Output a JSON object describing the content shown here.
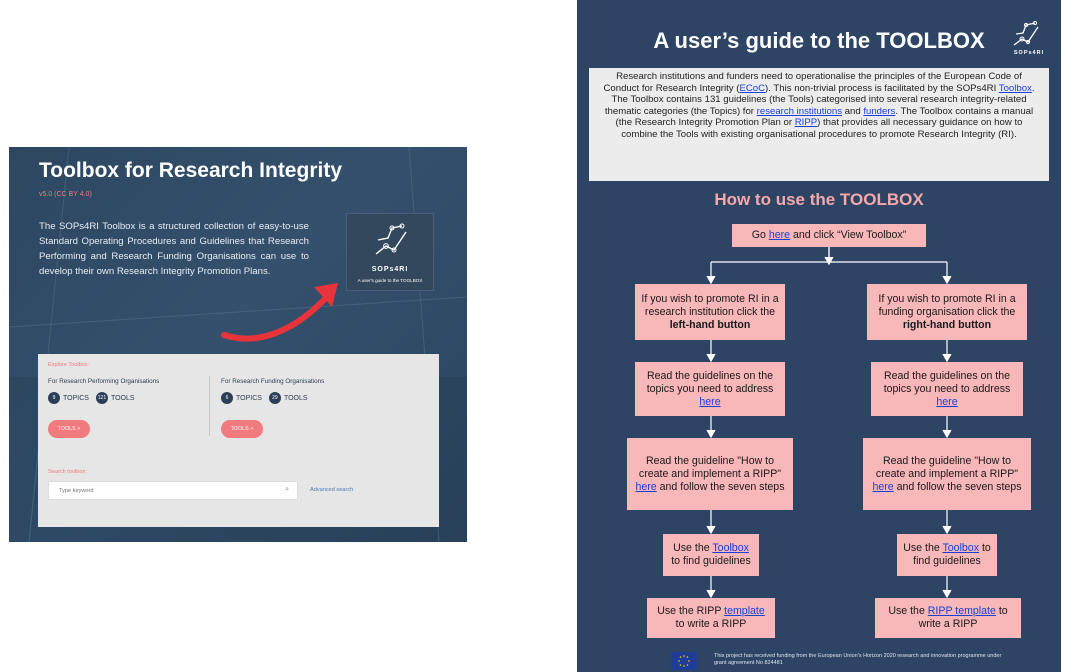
{
  "left_panel": {
    "title": "Toolbox for Research Integrity",
    "version": "v5.0 (CC BY 4.0)",
    "description": "The SOPs4RI Toolbox is a structured collection of easy-to-use Standard Operating Procedures and Guidelines that Research Performing and Research Funding Organisations can use to develop their own Research Integrity Promotion Plans.",
    "badge": {
      "brand": "SOPs4RI",
      "caption": "A user's guide to the TOOLBOX"
    },
    "explore": {
      "label": "Explore Toolbox:",
      "rpo": {
        "title": "For Research Performing Organisations",
        "topics_count": "9",
        "topics_label": "TOPICS",
        "tools_count": "121",
        "tools_label": "TOOLS",
        "button": "TOOLS >"
      },
      "rfo": {
        "title": "For Research Funding Organisations",
        "topics_count": "6",
        "topics_label": "TOPICS",
        "tools_count": "29",
        "tools_label": "TOOLS",
        "button": "TOOLS >"
      },
      "search_label": "Search toolbox:",
      "search_placeholder": "Type keyword",
      "advanced_search": "Advanced search"
    }
  },
  "poster": {
    "title": "A user’s guide to the TOOLBOX",
    "logo_text": "SOPs4RI",
    "intro": {
      "t1": "Research institutions and funders need to operationalise the principles of the European Code of Conduct for Research Integrity (",
      "l1": "ECoC",
      "t2": "). This non-trivial process is facilitated by the SOPs4RI ",
      "l2": "Toolbox",
      "t3": ". The Toolbox contains 131 guidelines (the Tools) categorised into several research integrity-related thematic categories (the Topics) for ",
      "l3": "research institutions",
      "t4": " and ",
      "l4": "funders",
      "t5": ". The Toolbox contains a manual (the Research Integrity Promotion Plan or ",
      "l5": "RIPP",
      "t6": ") that provides all necessary guidance on how to combine the Tools with existing organisational procedures to promote Research Integrity (RI)."
    },
    "how_title": "How to use the TOOLBOX",
    "start": {
      "t1": "Go ",
      "link": "here",
      "t2": " and click “View Toolbox”"
    },
    "left_col": {
      "b1_pre": "If you wish to promote RI in a research institution click the ",
      "b1_bold": "left-hand button",
      "b2_text": "Read the guidelines on the topics you need to address",
      "b2_link": "here",
      "b3_text": "Read the guideline \"How to create and implement a RIPP\"",
      "b3_link": "here",
      "b3_tail": " and follow the seven steps",
      "b4_pre": "Use the ",
      "b4_link": "Toolbox",
      "b4_tail": " to find guidelines",
      "b5_pre": "Use the RIPP ",
      "b5_link": "template",
      "b5_tail": " to write a RIPP"
    },
    "right_col": {
      "b1_pre": "If you wish to promote RI in a funding organisation click the ",
      "b1_bold": "right-hand button",
      "b2_text": "Read the guidelines on the topics you need to address",
      "b2_link": "here",
      "b3_text": "Read the guideline \"How to create and implement a RIPP\"",
      "b3_link": "here",
      "b3_tail": " and follow the seven steps",
      "b4_pre": "Use the ",
      "b4_link": "Toolbox",
      "b4_tail": " to find guidelines",
      "b5_pre": "Use the ",
      "b5_link": "RIPP template",
      "b5_tail": " to write a RIPP"
    },
    "footer": "This project has received funding from the European Union’s Horizon 2020 research and innovation programme under grant agreement No 824481"
  },
  "colors": {
    "panel_bg": "#2d4761",
    "poster_bg": "#2d4465",
    "accent_pink": "#f07a7e",
    "box_pink": "#f8b7b9",
    "link_blue": "#1b3fd6"
  }
}
